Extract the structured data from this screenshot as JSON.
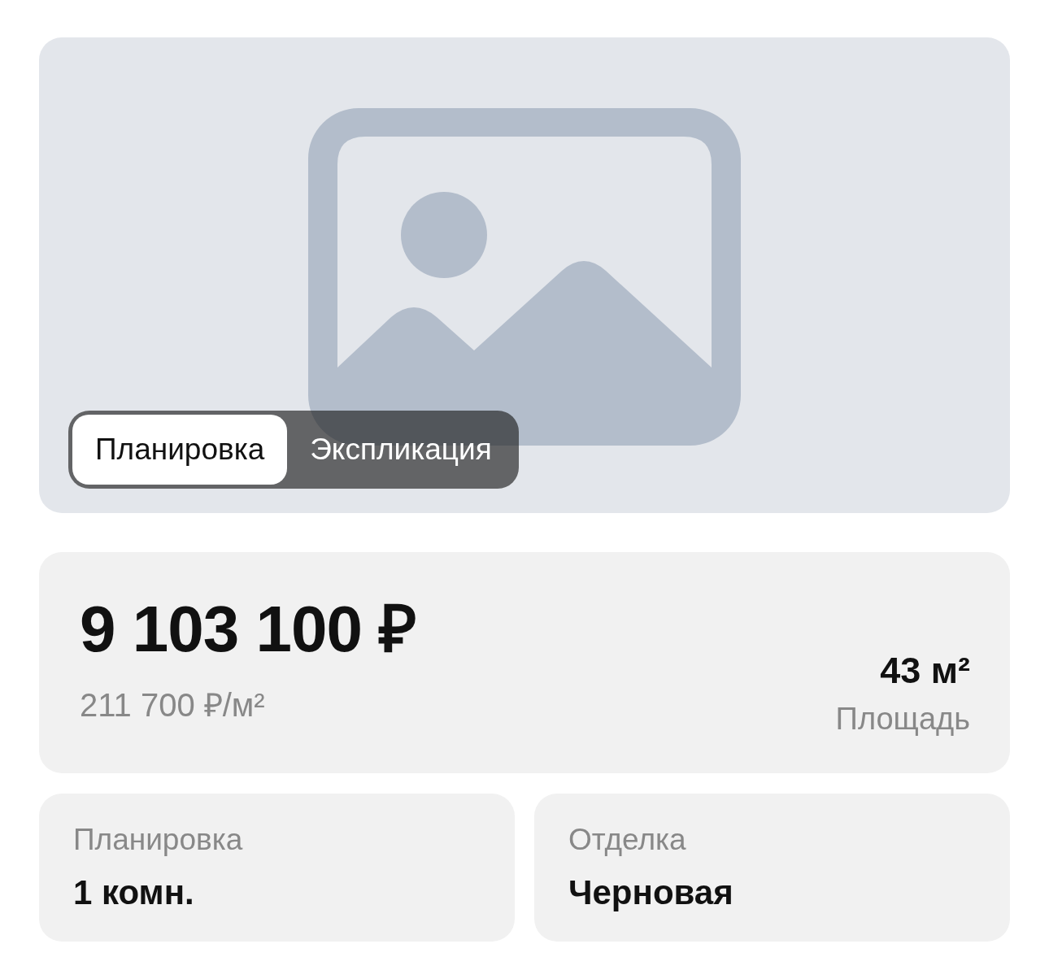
{
  "media": {
    "tabs": [
      {
        "label": "Планировка",
        "selected": true
      },
      {
        "label": "Экспликация",
        "selected": false
      }
    ]
  },
  "price": {
    "total": "9 103 100 ₽",
    "per_square_meter": "211 700 ₽/м²",
    "area": "43 м²",
    "area_label": "Площадь"
  },
  "details": [
    {
      "label": "Планировка",
      "value": "1 комн."
    },
    {
      "label": "Отделка",
      "value": "Черновая"
    }
  ]
}
